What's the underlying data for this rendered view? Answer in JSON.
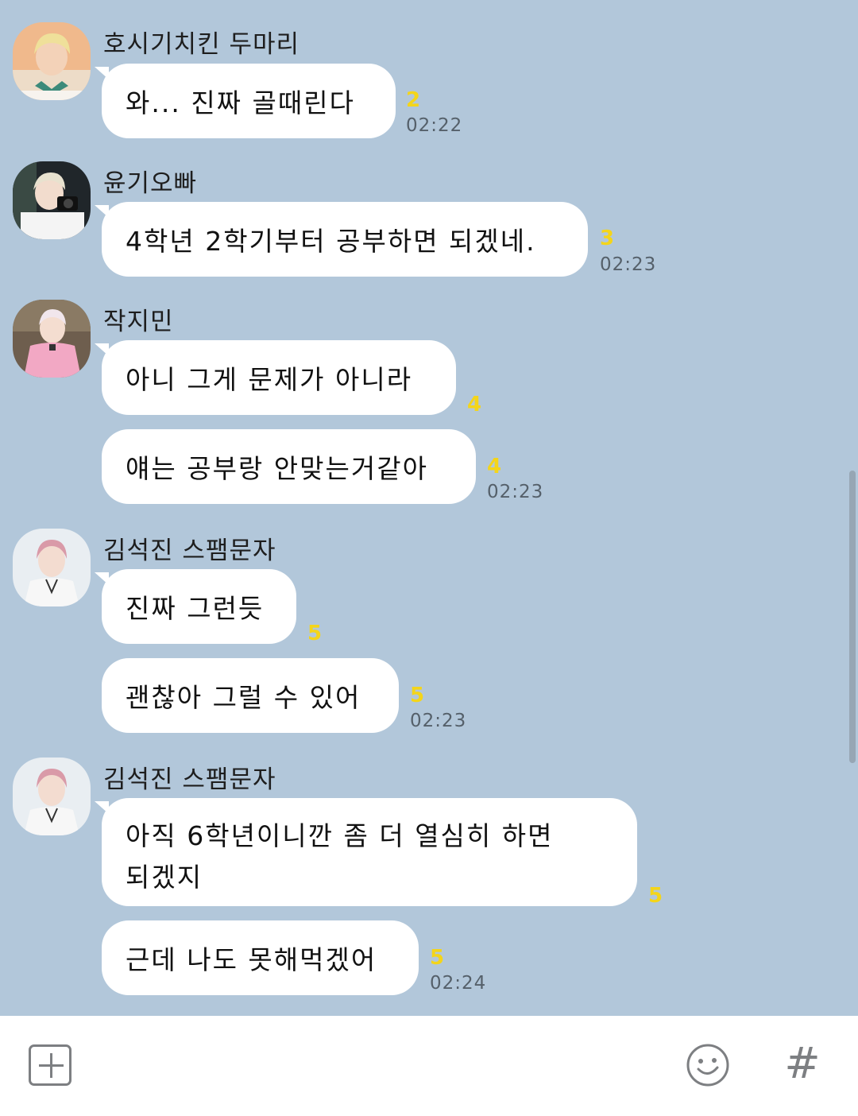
{
  "messages": [
    {
      "sender": "호시기치킨 두마리",
      "text": "와... 진짜 골때린다",
      "unread": "2",
      "time": "02:22"
    },
    {
      "sender": "윤기오빠",
      "text": "4학년 2학기부터 공부하면 되겠네.",
      "unread": "3",
      "time": "02:23"
    },
    {
      "sender": "작지민",
      "text": "아니 그게 문제가 아니라",
      "unread": "4",
      "time": ""
    },
    {
      "sender": "",
      "text": "얘는 공부랑 안맞는거같아",
      "unread": "4",
      "time": "02:23"
    },
    {
      "sender": "김석진 스팸문자",
      "text": "진짜 그런듯",
      "unread": "5",
      "time": ""
    },
    {
      "sender": "",
      "text": "괜찮아 그럴 수 있어",
      "unread": "5",
      "time": "02:23"
    },
    {
      "sender": "김석진 스팸문자",
      "text": "아직 6학년이니깐 좀 더 열심히 하면 되겠지",
      "unread": "5",
      "time": ""
    },
    {
      "sender": "",
      "text": "근데 나도 못해먹겠어",
      "unread": "5",
      "time": "02:24"
    }
  ],
  "input_bar": {
    "plus_icon": "plus-square-icon",
    "emoji_icon": "smiley-icon",
    "hash_icon": "hash-icon",
    "hash_glyph": "#"
  },
  "colors": {
    "background": "#b2c7da",
    "bubble": "#ffffff",
    "unread": "#f4d51a"
  }
}
